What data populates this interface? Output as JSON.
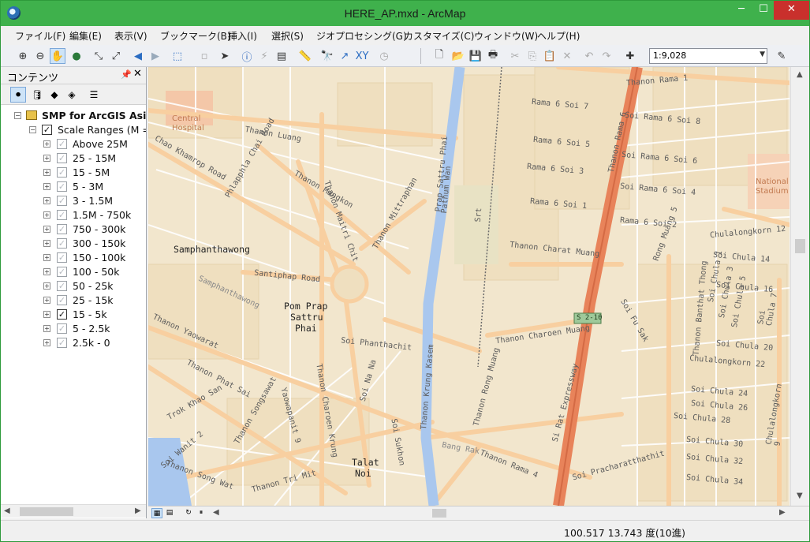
{
  "window": {
    "title": "HERE_AP.mxd - ArcMap",
    "minimize": "─",
    "maximize": "☐",
    "close": "✕"
  },
  "menu": [
    "ファイル(F)",
    "編集(E)",
    "表示(V)",
    "ブックマーク(B)",
    "挿入(I)",
    "選択(S)",
    "ジオプロセシング(G)",
    "カスタマイズ(C)",
    "ウィンドウ(W)",
    "ヘルプ(H)"
  ],
  "toolbar": {
    "scale": "1:9,028"
  },
  "toc": {
    "title": "コンテンツ",
    "pin": "📌",
    "close": "✕",
    "map_layer": "SMP for ArcGIS Asia",
    "group_layer": "Scale Ranges (M = Million, K = Thousand)",
    "ranges": [
      {
        "label": "Above 25M",
        "checked": false
      },
      {
        "label": "25 - 15M",
        "checked": false
      },
      {
        "label": "15 - 5M",
        "checked": false
      },
      {
        "label": "5 - 3M",
        "checked": false
      },
      {
        "label": "3 - 1.5M",
        "checked": false
      },
      {
        "label": "1.5M - 750k",
        "checked": false
      },
      {
        "label": "750 - 300k",
        "checked": false
      },
      {
        "label": "300 - 150k",
        "checked": false
      },
      {
        "label": "150 - 100k",
        "checked": false
      },
      {
        "label": "100 - 50k",
        "checked": false
      },
      {
        "label": "50 - 25k",
        "checked": false
      },
      {
        "label": "25 - 15k",
        "checked": false
      },
      {
        "label": "15 - 5k",
        "checked": true
      },
      {
        "label": "5 - 2.5k",
        "checked": false
      },
      {
        "label": "2.5k - 0",
        "checked": false
      }
    ]
  },
  "map": {
    "places": [
      "Samphanthawong",
      "Pom Prap",
      "Sattru",
      "Phai",
      "Talat",
      "Noi",
      "Central",
      "Hospital",
      "National",
      "Stadium"
    ],
    "roads": [
      "Thanon Luang",
      "Thanon Mangkon",
      "Chao Khamrop Road",
      "Phlapphla Chai Road",
      "Thanon Maitri Chit",
      "Thanon Mittraphan",
      "Santiphap Road",
      "Samphanthawong",
      "Thanon Yaowarat",
      "Thanon Phat Sai",
      "Trok Khao San",
      "Thanon Songsawat",
      "Yaowapanit 9",
      "Soi Wanit 2",
      "Thanon Song Wat",
      "Thanon Tri Mit",
      "Thanon Charoen Krung",
      "Soi Phanthachit",
      "Soi Na Na",
      "Thanon Krung Kasem",
      "Soi Sukhon",
      "Thanon Rong Muang",
      "Thanon Charoen Muang",
      "Thanon Charat Muang",
      "Thanon Rama 4",
      "Bang Rak",
      "Thanon Rama 1",
      "Rama 6 Soi 7",
      "Rama 6 Soi 5",
      "Rama 6 Soi 3",
      "Rama 6 Soi 1",
      "Soi Rama 6 Soi 8",
      "Soi Rama 6 Soi 6",
      "Soi Rama 6 Soi 4",
      "Rama 6 Soi 2",
      "Thanon Rama 6",
      "Rong Muang 5",
      "Chulalongkorn 12",
      "Soi Chula 14",
      "Soi Chula 16",
      "Soi Chula 20",
      "Chulalongkorn 22",
      "Soi Chula 24",
      "Soi Chula 26",
      "Soi Chula 28",
      "Soi Chula 30",
      "Soi Chula 32",
      "Soi Chula 34",
      "Soi Chula 1",
      "Soi Chula 3",
      "Soi Chula 5",
      "Soi Chula 7",
      "Chulalongkorn 9",
      "Thanon Banthat Thong",
      "Soi Pracharatthathit",
      "Soi Fu Sak",
      "Si Rat Expressway",
      "S 2-10",
      "Prap Sattru Phai",
      "Pathum Wan",
      "Srt"
    ]
  },
  "status": {
    "coords": "100.517  13.743 度(10進)"
  },
  "colors": {
    "titlebar": "#3fb14c",
    "map_bg": "#f2e6cd",
    "road": "#f8cfa0",
    "expressway": "#e8835a",
    "canal": "#a9c7ee",
    "label": "#5c5c5c"
  }
}
